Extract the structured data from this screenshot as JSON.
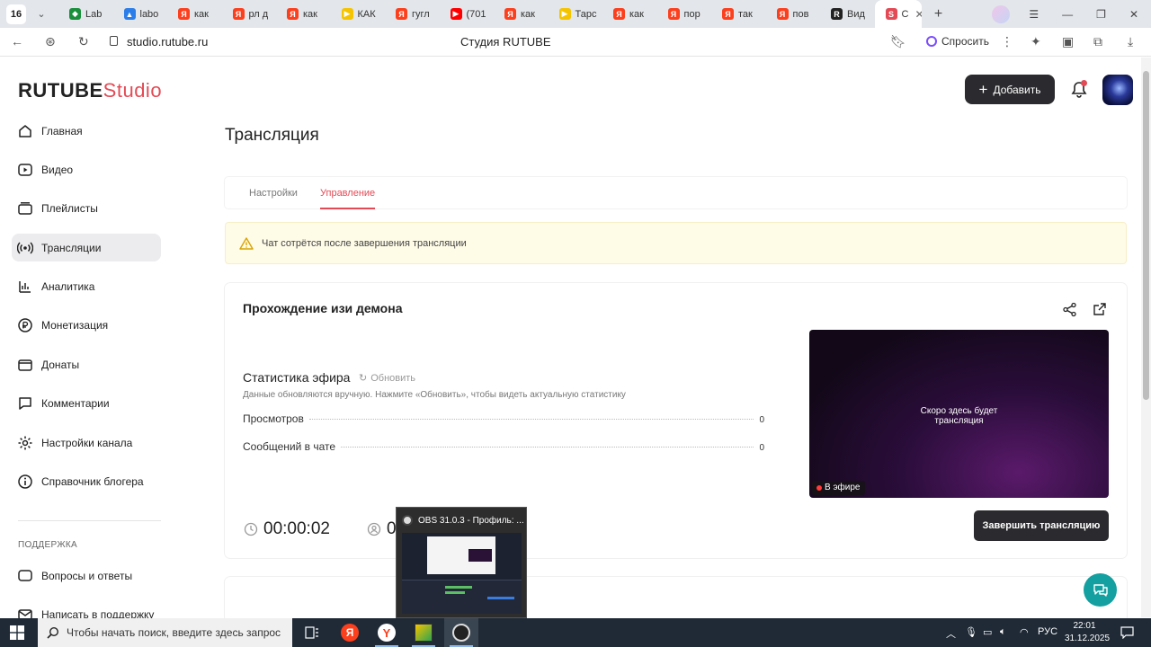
{
  "browser": {
    "tab_count": "16",
    "tabs": [
      {
        "label": "Lab",
        "color": "#1a8f3c",
        "glyph": "◆"
      },
      {
        "label": "labo",
        "color": "#2b7de9",
        "glyph": "▲"
      },
      {
        "label": "как",
        "color": "#fc3f1d",
        "glyph": "Я"
      },
      {
        "label": "рл д",
        "color": "#fc3f1d",
        "glyph": "Я"
      },
      {
        "label": "как",
        "color": "#fc3f1d",
        "glyph": "Я"
      },
      {
        "label": "КАК",
        "color": "#f5c400",
        "glyph": "▶"
      },
      {
        "label": "гугл",
        "color": "#fc3f1d",
        "glyph": "Я"
      },
      {
        "label": "(701",
        "color": "#ff0000",
        "glyph": "▶"
      },
      {
        "label": "как",
        "color": "#fc3f1d",
        "glyph": "Я"
      },
      {
        "label": "Тарс",
        "color": "#f5c400",
        "glyph": "▶"
      },
      {
        "label": "как",
        "color": "#fc3f1d",
        "glyph": "Я"
      },
      {
        "label": "пор",
        "color": "#fc3f1d",
        "glyph": "Я"
      },
      {
        "label": "так",
        "color": "#fc3f1d",
        "glyph": "Я"
      },
      {
        "label": "пов",
        "color": "#fc3f1d",
        "glyph": "Я"
      },
      {
        "label": "Вид",
        "color": "#222222",
        "glyph": "R"
      },
      {
        "label": "С",
        "color": "#e34a55",
        "glyph": "S"
      }
    ],
    "url": "studio.rutube.ru",
    "page_title": "Студия RUTUBE",
    "ask_label": "Спросить"
  },
  "app": {
    "logo_main": "RUTUBE",
    "logo_studio": "Studio",
    "add_button": "Добавить",
    "accent": "#e34a55",
    "sidebar": [
      {
        "label": "Главная",
        "icon": "home-icon"
      },
      {
        "label": "Видео",
        "icon": "video-icon"
      },
      {
        "label": "Плейлисты",
        "icon": "playlist-icon"
      },
      {
        "label": "Трансляции",
        "icon": "broadcast-icon",
        "active": true
      },
      {
        "label": "Аналитика",
        "icon": "analytics-icon"
      },
      {
        "label": "Монетизация",
        "icon": "money-icon"
      },
      {
        "label": "Донаты",
        "icon": "donate-icon"
      },
      {
        "label": "Комментарии",
        "icon": "comment-icon"
      },
      {
        "label": "Настройки канала",
        "icon": "gear-icon"
      },
      {
        "label": "Справочник блогера",
        "icon": "info-icon"
      }
    ],
    "support_title": "ПОДДЕРЖКА",
    "support_items": [
      {
        "label": "Вопросы и ответы",
        "icon": "faq-icon"
      },
      {
        "label": "Написать в поддержку",
        "icon": "mail-icon"
      }
    ]
  },
  "main": {
    "title": "Трансляция",
    "tabs": [
      {
        "label": "Настройки",
        "active": false
      },
      {
        "label": "Управление",
        "active": true
      }
    ],
    "warning": "Чат сотрётся после завершения трансляции",
    "stream_name": "Прохождение изи демона",
    "stats_title": "Статистика эфира",
    "refresh_label": "Обновить",
    "stats_subtitle": "Данные обновляются вручную. Нажмите «Обновить», чтобы видеть актуальную статистику",
    "stats": [
      {
        "label": "Просмотров",
        "value": "0"
      },
      {
        "label": "Сообщений в чате",
        "value": "0"
      }
    ],
    "preview_text_1": "Скоро здесь будет",
    "preview_text_2": "трансляция",
    "live_label": "В эфире",
    "end_button": "Завершить трансляцию",
    "timer": "00:00:02",
    "viewers": "0"
  },
  "obs_thumbnail": {
    "title": "OBS 31.0.3 - Профиль: ..."
  },
  "taskbar": {
    "search_placeholder": "Чтобы начать поиск, введите здесь запрос",
    "language": "РУС",
    "time": "22:01",
    "date": "31.12.2025"
  }
}
